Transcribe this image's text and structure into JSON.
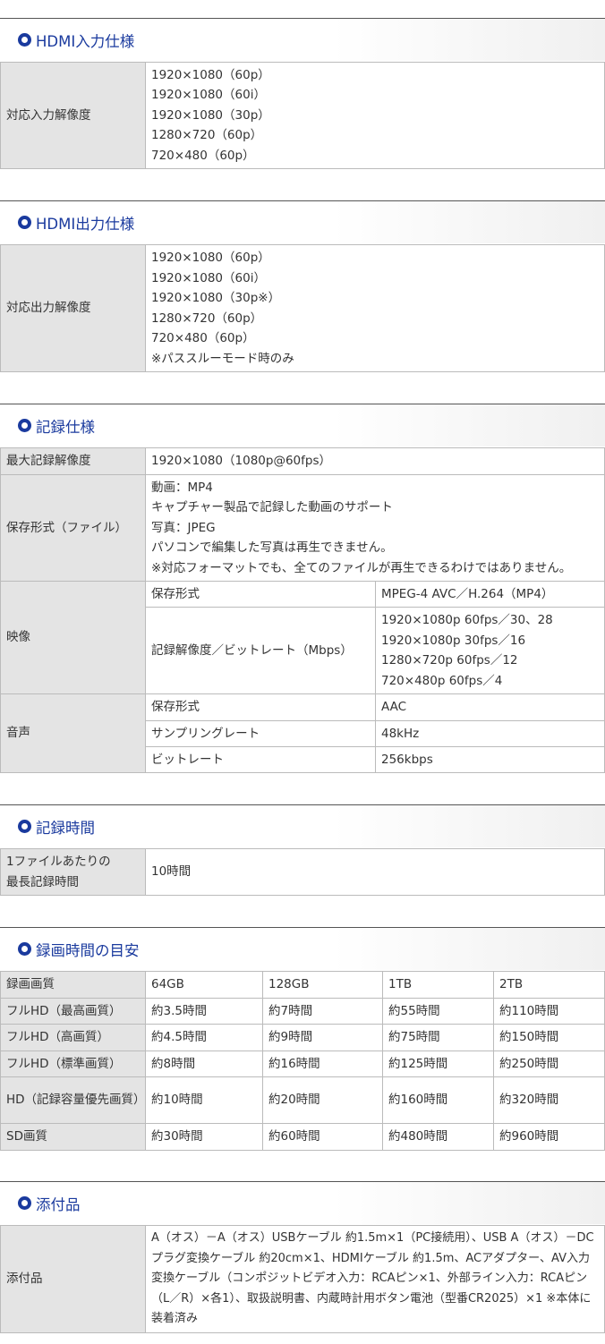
{
  "hdmi_in": {
    "title": "HDMI入力仕様",
    "label": "対応入力解像度",
    "values": [
      "1920×1080（60p）",
      "1920×1080（60i）",
      "1920×1080（30p）",
      "1280×720（60p）",
      "720×480（60p）"
    ]
  },
  "hdmi_out": {
    "title": "HDMI出力仕様",
    "label": "対応出力解像度",
    "values": [
      "1920×1080（60p）",
      "1920×1080（60i）",
      "1920×1080（30p※）",
      "1280×720（60p）",
      "720×480（60p）",
      "※パススルーモード時のみ"
    ]
  },
  "record": {
    "title": "記録仕様",
    "max_res_label": "最大記録解像度",
    "max_res_value": "1920×1080（1080p@60fps）",
    "format_label": "保存形式（ファイル）",
    "format_values": [
      "動画：MP4",
      "キャプチャー製品で記録した動画のサポート",
      "写真：JPEG",
      "パソコンで編集した写真は再生できません。",
      "※対応フォーマットでも、全てのファイルが再生できるわけではありません。"
    ],
    "video_label": "映像",
    "video_format_label": "保存形式",
    "video_format_value": "MPEG-4 AVC／H.264（MP4）",
    "video_bitrate_label": "記録解像度／ビットレート（Mbps）",
    "video_bitrate_values": [
      "1920×1080p 60fps／30、28",
      "1920×1080p 30fps／16",
      "1280×720p 60fps／12",
      "720×480p 60fps／4"
    ],
    "audio_label": "音声",
    "audio_format_label": "保存形式",
    "audio_format_value": "AAC",
    "audio_sampling_label": "サンプリングレート",
    "audio_sampling_value": "48kHz",
    "audio_bitrate_label": "ビットレート",
    "audio_bitrate_value": "256kbps"
  },
  "rec_time": {
    "title": "記録時間",
    "label_lines": [
      "1ファイルあたりの",
      "最長記録時間"
    ],
    "value": "10時間"
  },
  "estimate": {
    "title": "録画時間の目安",
    "headers": [
      "録画画質",
      "64GB",
      "128GB",
      "1TB",
      "2TB"
    ],
    "rows": [
      [
        "フルHD（最高画質）",
        "約3.5時間",
        "約7時間",
        "約55時間",
        "約110時間"
      ],
      [
        "フルHD（高画質）",
        "約4.5時間",
        "約9時間",
        "約75時間",
        "約150時間"
      ],
      [
        "フルHD（標準画質）",
        "約8時間",
        "約16時間",
        "約125時間",
        "約250時間"
      ],
      [
        "HD（記録容量優先画質）",
        "約10時間",
        "約20時間",
        "約160時間",
        "約320時間"
      ],
      [
        "SD画質",
        "約30時間",
        "約60時間",
        "約480時間",
        "約960時間"
      ]
    ]
  },
  "accessories": {
    "title": "添付品",
    "label": "添付品",
    "value": "A（オス）－A（オス）USBケーブル 約1.5m×1（PC接続用）、USB A（オス）－DCプラグ変換ケーブル 約20cm×1、HDMIケーブル 約1.5m、ACアダプター、AV入力変換ケーブル（コンポジットビデオ入力：RCAピン×1、外部ライン入力：RCAピン（L／R）×各1）、取扱説明書、内蔵時計用ボタン電池（型番CR2025）×1 ※本体に装着済み"
  }
}
